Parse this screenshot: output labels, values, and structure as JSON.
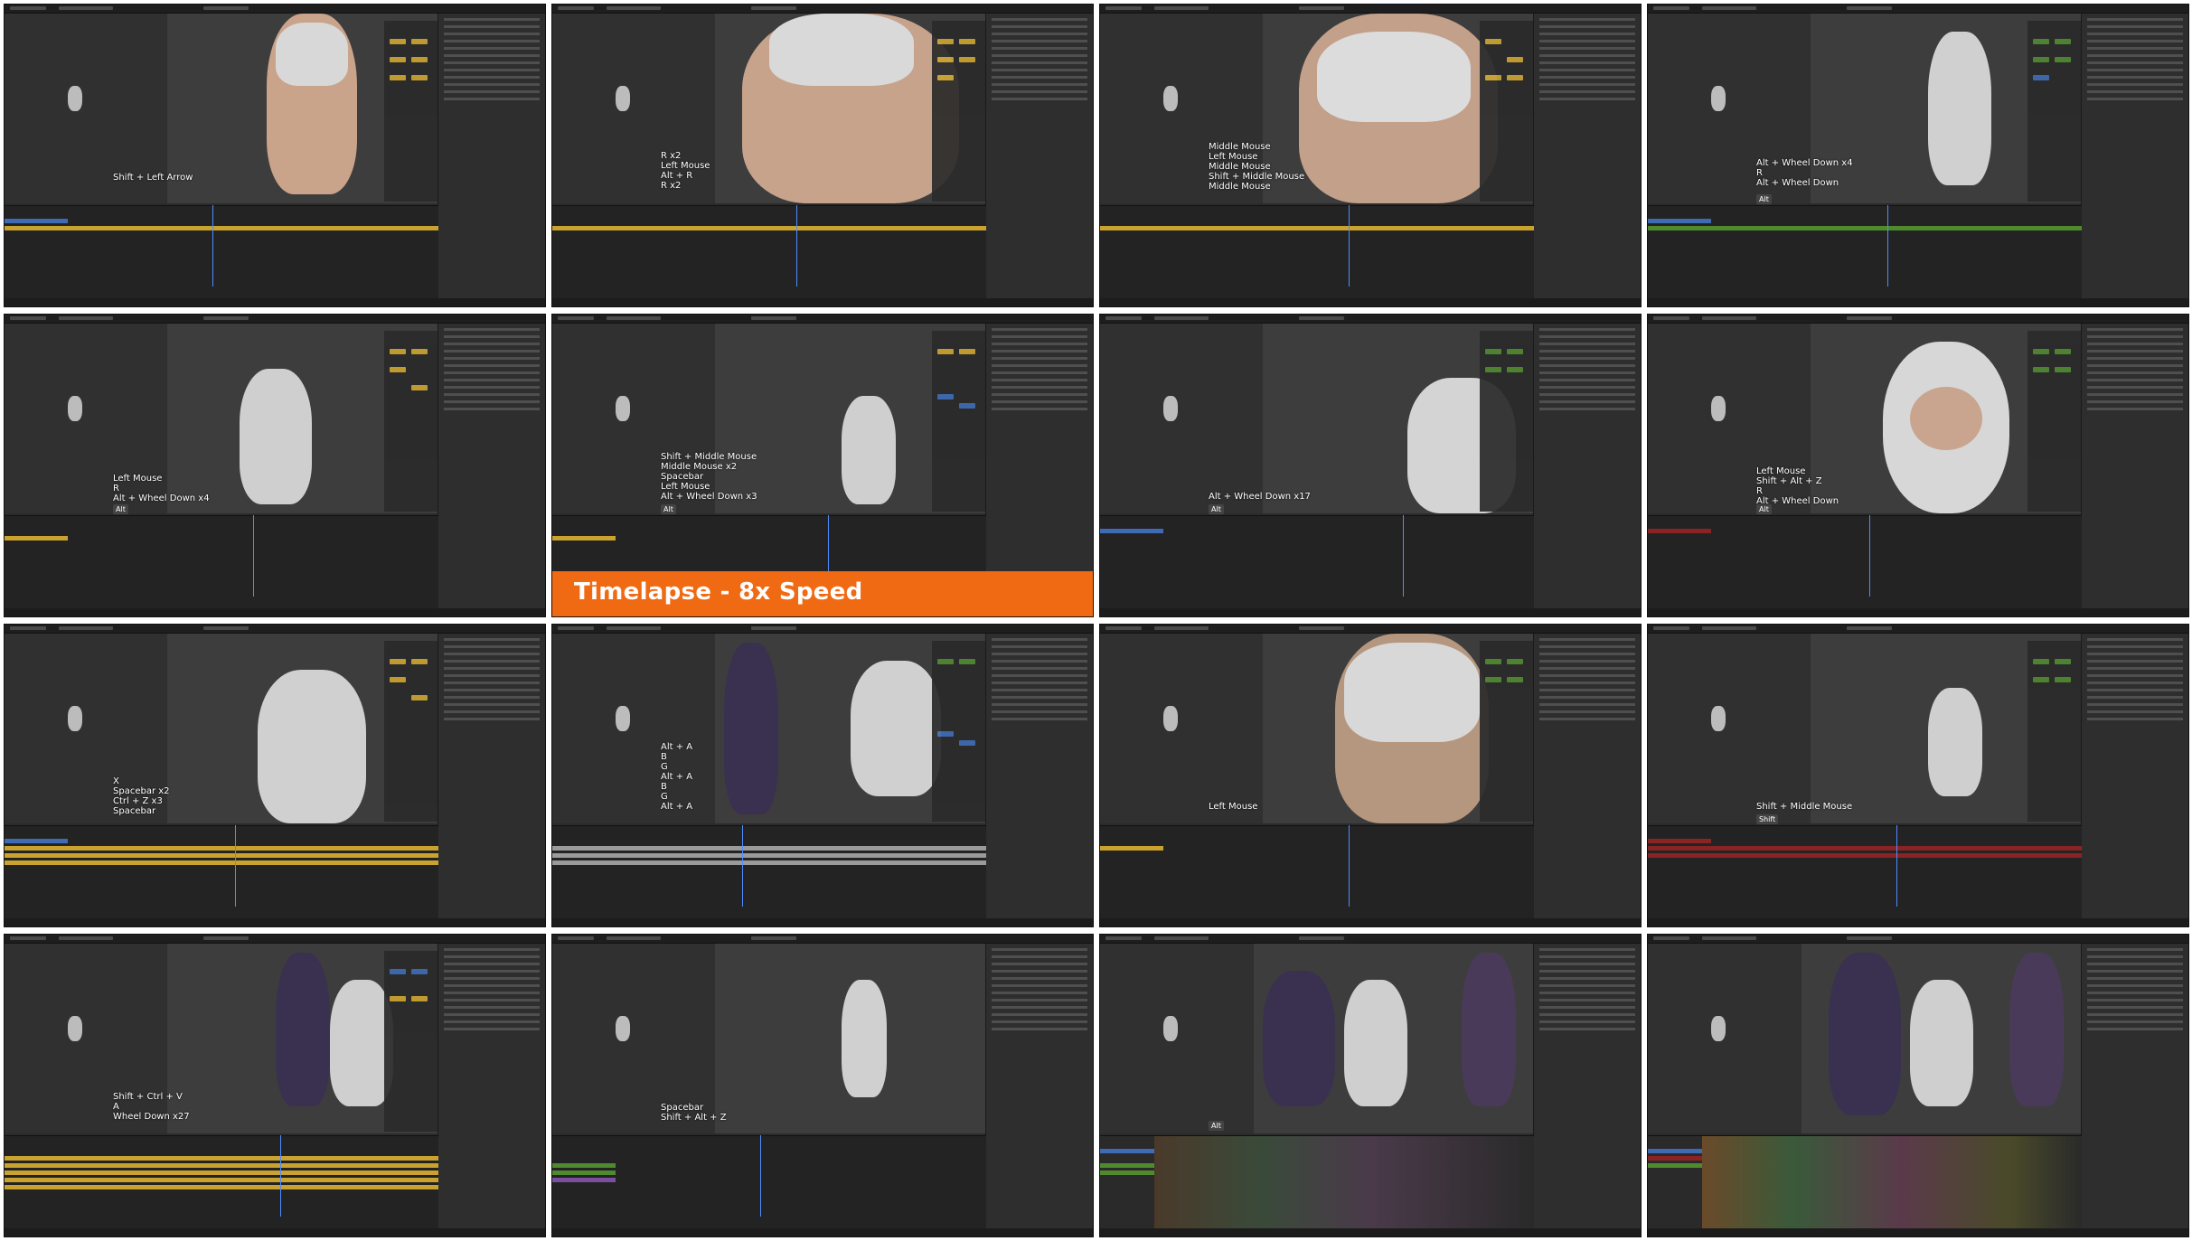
{
  "timelapse_banner": "Timelapse - 8x Speed",
  "colors": {
    "banner_orange": "#f06a14",
    "keyframe_yellow": "#c9a22f",
    "keyframe_green": "#4f8a2f",
    "keyframe_red": "#8a2424",
    "selection_blue": "#3e6bb3"
  },
  "panels": [
    {
      "id": 1,
      "keys": "Shift + Left Arrow",
      "chip": ""
    },
    {
      "id": 2,
      "keys": "R x2\nLeft Mouse\nAlt + R\nR x2",
      "chip": ""
    },
    {
      "id": 3,
      "keys": "Middle Mouse\nLeft Mouse\nMiddle Mouse\nShift + Middle Mouse\nMiddle Mouse",
      "chip": ""
    },
    {
      "id": 4,
      "keys": "Alt + Wheel Down x4\nR\nAlt + Wheel Down",
      "chip": "Alt"
    },
    {
      "id": 5,
      "keys": "Left Mouse\nR\nAlt + Wheel Down x4",
      "chip": "Alt"
    },
    {
      "id": 6,
      "keys": "Shift + Middle Mouse\nMiddle Mouse x2\nSpacebar\nLeft Mouse\nAlt + Wheel Down x3",
      "chip": "Alt"
    },
    {
      "id": 7,
      "keys": "Alt + Wheel Down x17",
      "chip": "Alt"
    },
    {
      "id": 8,
      "keys": "Left Mouse\nShift + Alt + Z\nR\nAlt + Wheel Down",
      "chip": "Alt"
    },
    {
      "id": 9,
      "keys": "X\nSpacebar x2\nCtrl + Z x3\nSpacebar",
      "chip": ""
    },
    {
      "id": 10,
      "keys": "Alt + A\nB\nG\nAlt + A\nB\nG\nAlt + A",
      "chip": ""
    },
    {
      "id": 11,
      "keys": "Left Mouse",
      "chip": ""
    },
    {
      "id": 12,
      "keys": "Shift + Middle Mouse",
      "chip": "Shift"
    },
    {
      "id": 13,
      "keys": "Shift + Ctrl + V\nA\nWheel Down x27",
      "chip": ""
    },
    {
      "id": 14,
      "keys": "Spacebar\nShift + Alt + Z",
      "chip": ""
    },
    {
      "id": 15,
      "keys": "",
      "chip": "Alt"
    },
    {
      "id": 16,
      "keys": "",
      "chip": ""
    }
  ]
}
